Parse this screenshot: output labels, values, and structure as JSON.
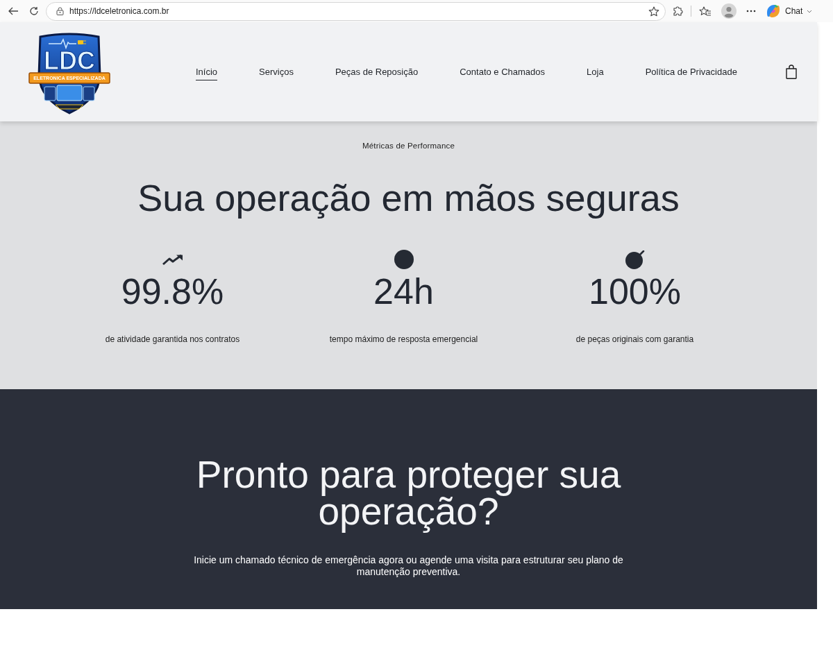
{
  "browser": {
    "url": "https://ldceletronica.com.br",
    "chat_label": "Chat"
  },
  "header": {
    "logo": {
      "title": "LDC",
      "tagline": "ELETRONICA ESPECIALIZADA"
    },
    "nav": [
      {
        "label": "Início",
        "selected": true
      },
      {
        "label": "Serviços",
        "selected": false
      },
      {
        "label": "Peças de Reposição",
        "selected": false
      },
      {
        "label": "Contato e Chamados",
        "selected": false
      },
      {
        "label": "Loja",
        "selected": false
      },
      {
        "label": "Política de Privacidade",
        "selected": false
      }
    ]
  },
  "metrics": {
    "eyebrow": "Métricas de Performance",
    "title": "Sua operação em mãos seguras",
    "items": [
      {
        "kind": "trend",
        "value": "99.8%",
        "caption": "de atividade garantida nos contratos"
      },
      {
        "kind": "dot",
        "value": "24h",
        "caption": "tempo máximo de resposta emergencial"
      },
      {
        "kind": "bomb",
        "value": "100%",
        "caption": "de peças originais com garantia"
      }
    ]
  },
  "cta": {
    "title": "Pronto para proteger sua operação?",
    "text": "Inicie um chamado técnico de emergência agora ou agende uma visita para estruturar seu plano de manutenção preventiva."
  }
}
